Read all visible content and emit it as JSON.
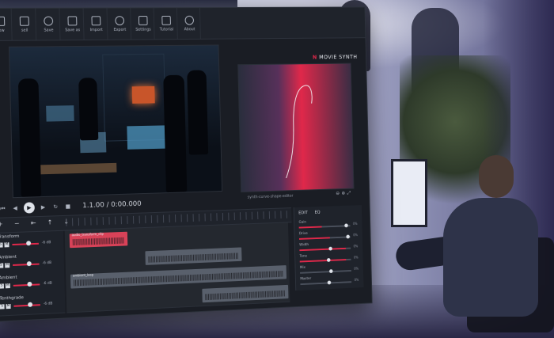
{
  "toolbar": {
    "items": [
      {
        "label": "new",
        "icon": "new-file-icon"
      },
      {
        "label": "sell",
        "icon": "tag-icon"
      },
      {
        "label": "Save",
        "icon": "save-icon"
      },
      {
        "label": "Save as",
        "icon": "save-as-icon"
      },
      {
        "label": "Import",
        "icon": "import-icon"
      },
      {
        "label": "Export",
        "icon": "export-icon"
      },
      {
        "label": "Settings",
        "icon": "gear-icon"
      },
      {
        "label": "Tutorial",
        "icon": "book-icon"
      },
      {
        "label": "About",
        "icon": "info-icon"
      }
    ]
  },
  "brand": {
    "logo_mark": "N",
    "name": "MOVIE SYNTH"
  },
  "graph": {
    "caption": "synth-curve-shape-editor",
    "icons": [
      "zoom-out-icon",
      "zoom-in-icon",
      "fit-icon"
    ]
  },
  "transport": {
    "timecode": "1.1.00 / 0:00.000"
  },
  "timeline": {
    "tools": "+ − ⇤ ↑ ↓"
  },
  "tracks": [
    {
      "name": "Transform",
      "db": "-6 dB",
      "clips": [
        {
          "label": "audio_transform_clip",
          "style": "red"
        }
      ]
    },
    {
      "name": "Ambient",
      "db": "-6 dB",
      "clips": [
        {
          "label": "",
          "style": "grey"
        }
      ]
    },
    {
      "name": "Ambient",
      "db": "-6 dB",
      "clips": [
        {
          "label": "ambient_loop",
          "style": "grey"
        }
      ]
    },
    {
      "name": "Tenthgrade",
      "db": "-6 dB",
      "clips": [
        {
          "label": "",
          "style": "grey"
        }
      ]
    }
  ],
  "mixer": {
    "tabs": [
      "EDIT",
      "EQ"
    ],
    "rows": [
      {
        "name": "Gain",
        "value": "0%",
        "level": 0.45,
        "knob": 0.92
      },
      {
        "name": "Drive",
        "value": "0%",
        "level": 0.6,
        "knob": 0.95
      },
      {
        "name": "Width",
        "value": "0%",
        "level": 0.9,
        "knob": 0.6
      },
      {
        "name": "Tone",
        "value": "0%",
        "level": 0.9,
        "knob": 0.55
      },
      {
        "name": "Mix",
        "value": "0%",
        "level": 0.0,
        "knob": 0.6
      },
      {
        "name": "Master",
        "value": "0%",
        "level": 0.0,
        "knob": 0.55
      }
    ]
  },
  "colors": {
    "accent": "#e0284a",
    "panel": "#1a1d24"
  }
}
